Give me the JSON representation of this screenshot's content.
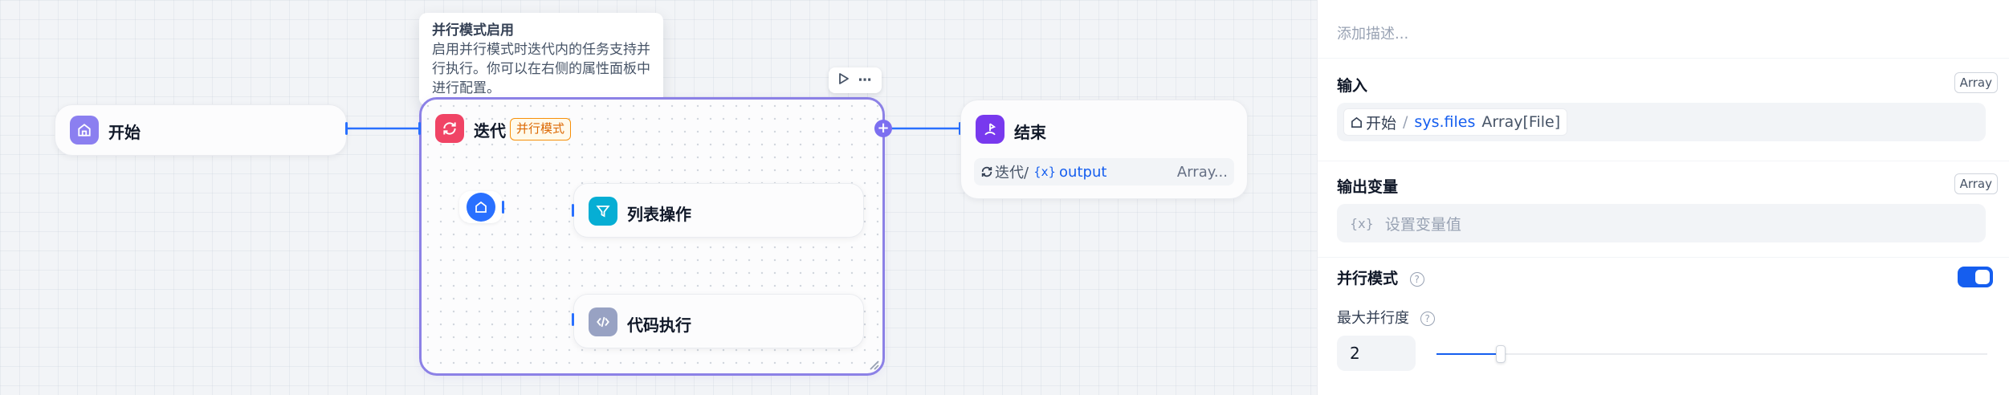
{
  "canvas": {
    "start_node": {
      "title": "开始"
    },
    "iteration_node": {
      "title": "迭代",
      "badge": "并行模式",
      "children": [
        {
          "title": "列表操作"
        },
        {
          "title": "代码执行"
        }
      ]
    },
    "end_node": {
      "title": "结束",
      "output_source": "迭代/",
      "output_var_icon": "{x}",
      "output_var": "output",
      "output_type": "Array..."
    },
    "tooltip": {
      "title": "并行模式启用",
      "body": "启用并行模式时迭代内的任务支持并行执行。你可以在右侧的属性面板中进行配置。"
    },
    "colors": {
      "start_icon": "#8b7ff0",
      "iteration_icon": "#f04465",
      "end_icon": "#7839ee",
      "list_icon": "#06aed4",
      "code_icon": "#98a2c3",
      "start_child": "#2970ff",
      "edge": "#2970ff",
      "iteration_border": "#8c81e6"
    }
  },
  "panel": {
    "description_placeholder": "添加描述...",
    "input": {
      "label": "输入",
      "type": "Array",
      "source_node": "开始",
      "separator": "/",
      "variable": "sys.files",
      "var_type": "Array[File]"
    },
    "output": {
      "label": "输出变量",
      "type": "Array",
      "var_icon": "{x}",
      "placeholder": "设置变量值"
    },
    "parallel": {
      "label": "并行模式",
      "enabled": true
    },
    "max_parallel": {
      "label": "最大并行度",
      "value": "2",
      "slider_fraction": 0.11
    }
  }
}
